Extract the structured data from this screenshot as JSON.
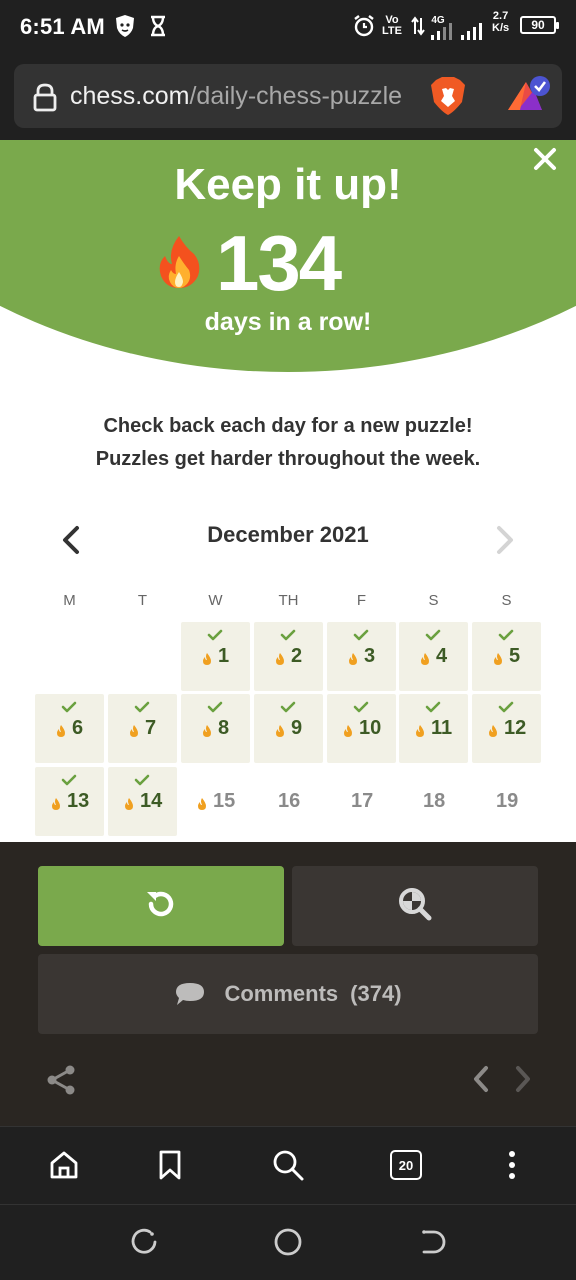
{
  "status_bar": {
    "time": "6:51 AM",
    "speed_top": "2.7",
    "speed_unit": "K/s",
    "battery": "90",
    "network_label": "4G",
    "volte_label": "Vo LTE"
  },
  "browser": {
    "url_host": "chess.com",
    "url_path": "/daily-chess-puzzle",
    "tab_count": "20"
  },
  "hero": {
    "title": "Keep it up!",
    "streak_count": "134",
    "streak_label": "days in a row!"
  },
  "info": {
    "line1": "Check back each day for a new puzzle!",
    "line2": "Puzzles get harder throughout the week."
  },
  "calendar": {
    "month_label": "December 2021",
    "weekdays": [
      "M",
      "T",
      "W",
      "TH",
      "F",
      "S",
      "S"
    ],
    "days": [
      {
        "n": "1",
        "solved": true
      },
      {
        "n": "2",
        "solved": true
      },
      {
        "n": "3",
        "solved": true
      },
      {
        "n": "4",
        "solved": true
      },
      {
        "n": "5",
        "solved": true
      },
      {
        "n": "6",
        "solved": true
      },
      {
        "n": "7",
        "solved": true
      },
      {
        "n": "8",
        "solved": true
      },
      {
        "n": "9",
        "solved": true
      },
      {
        "n": "10",
        "solved": true
      },
      {
        "n": "11",
        "solved": true
      },
      {
        "n": "12",
        "solved": true
      },
      {
        "n": "13",
        "solved": true
      },
      {
        "n": "14",
        "solved": true
      },
      {
        "n": "15",
        "solved": false,
        "today": true
      },
      {
        "n": "16",
        "solved": false
      },
      {
        "n": "17",
        "solved": false
      },
      {
        "n": "18",
        "solved": false
      },
      {
        "n": "19",
        "solved": false
      }
    ]
  },
  "actions": {
    "comments_label": "Comments",
    "comments_count": "(374)"
  },
  "colors": {
    "accent_green": "#7aa94c",
    "solved_bg": "#f2f1e6",
    "check_green": "#6aa03f",
    "flame_orange": "#f0a020",
    "panel_bg": "#2a2622",
    "button_dark": "#3a3633"
  },
  "icons": {
    "lock": "lock-icon",
    "brave": "brave-lion-icon",
    "rewards": "brave-rewards-icon",
    "close": "close-icon",
    "fire": "fire-emoji-icon",
    "retry": "retry-icon",
    "analyze": "analysis-magnifier-icon",
    "comment": "comment-bubble-icon",
    "share": "share-icon"
  }
}
